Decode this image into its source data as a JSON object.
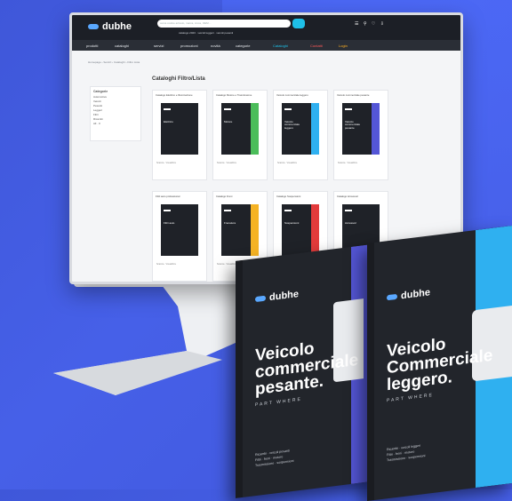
{
  "brand": {
    "name": "dubhe"
  },
  "header": {
    "search_placeholder": "cerca codice articolo, marca, cross, OEM…",
    "top_icons": "☰ ⚲ ♡ ⇩",
    "subline": "catalogo 2023 · veicoli leggeri · veicoli pesanti"
  },
  "nav": {
    "items": [
      "prodotti",
      "cataloghi",
      "servizi",
      "promozioni",
      "novità",
      "categorie",
      "Cataloghi",
      "Contatti",
      "Login"
    ]
  },
  "breadcrumb": "Homepage › Servizi › Cataloghi › Filtro Lista",
  "page_title": "Cataloghi  Filtro/Lista",
  "sidebar": {
    "title": "Categorie",
    "rows": [
      "Automotive",
      "Veicoli",
      "Pesanti",
      "Leggeri",
      "Filtri",
      "Ricambi",
      "All · 0"
    ]
  },
  "cards": [
    {
      "title": "Catalogo Elettrico e Illuminazione",
      "cover_text": "Elettrico",
      "stripe": "#1f2228"
    },
    {
      "title": "Catalogo Motore e Trasmissione",
      "cover_text": "Motore",
      "stripe": "#4bbd5a"
    },
    {
      "title": "Veicolo commerciale leggero",
      "cover_text": "Veicolo commerciale leggero",
      "stripe": "#2fb0f0"
    },
    {
      "title": "Veicolo commerciale pesante",
      "cover_text": "Veicolo commerciale pesante",
      "stripe": "#5456d6"
    },
    {
      "title": "Filtri auto professional",
      "cover_text": "Filtri auto",
      "stripe": "#1f2228"
    },
    {
      "title": "Catalogo Freni",
      "cover_text": "Frenatura",
      "stripe": "#f5b324"
    },
    {
      "title": "Catalogo Sospensioni",
      "cover_text": "Sospensioni",
      "stripe": "#e23b3b"
    },
    {
      "title": "Catalogo Accessori",
      "cover_text": "Accessori",
      "stripe": "#1f2228"
    }
  ],
  "card_foot": "Scarica · Visualizza",
  "books": [
    {
      "title": [
        "Veicolo",
        "commerciale",
        "pesante."
      ],
      "subtitle": "PART WHERE",
      "foot": [
        "Ricambi · veicoli pesanti",
        "Filtri · freni · motore",
        "Trasmissione · sospensioni"
      ],
      "edge": "#5456d6"
    },
    {
      "title": [
        "Veicolo",
        "Commerciale",
        "leggero."
      ],
      "subtitle": "PART WHERE",
      "foot": [
        "Ricambi · veicoli leggeri",
        "Filtri · freni · motore",
        "Trasmissione · sospensioni"
      ],
      "edge": "#2fb0f0"
    }
  ]
}
